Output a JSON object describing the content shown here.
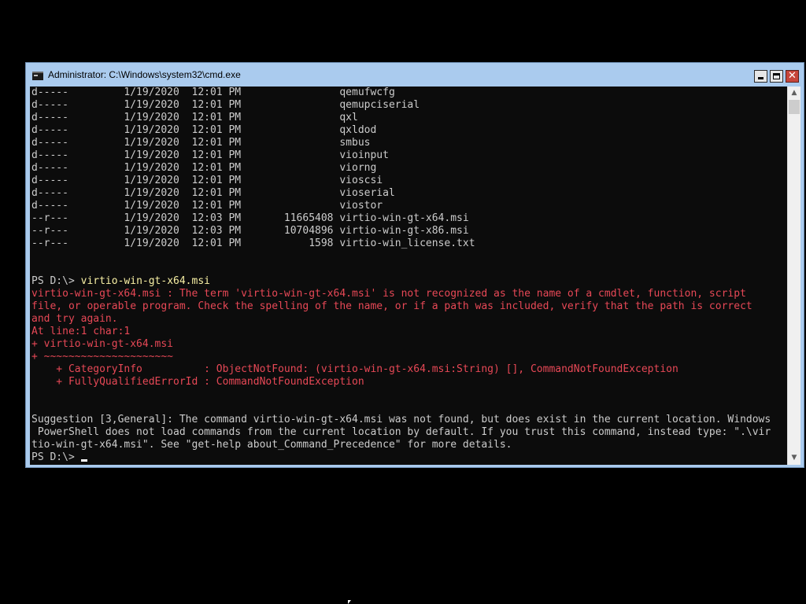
{
  "window": {
    "title": "Administrator: C:\\Windows\\system32\\cmd.exe",
    "icons": {
      "app": "console-icon",
      "minimize": "minimize-icon",
      "maximize": "maximize-icon",
      "close": "close-icon",
      "scroll_up": "chevron-up-icon",
      "scroll_down": "chevron-down-icon"
    },
    "close_glyph": "✕",
    "scroll_up_glyph": "▲",
    "scroll_down_glyph": "▼"
  },
  "colors": {
    "console_background": "#0c0c0c",
    "output_text": "#cccccc",
    "error_text": "#e74856",
    "command_text": "#f9f1a5",
    "titlebar": "#aacbee",
    "close_button": "#c7453a"
  },
  "console": {
    "listing": [
      "d-----         1/19/2020  12:01 PM                qemufwcfg",
      "d-----         1/19/2020  12:01 PM                qemupciserial",
      "d-----         1/19/2020  12:01 PM                qxl",
      "d-----         1/19/2020  12:01 PM                qxldod",
      "d-----         1/19/2020  12:01 PM                smbus",
      "d-----         1/19/2020  12:01 PM                vioinput",
      "d-----         1/19/2020  12:01 PM                viorng",
      "d-----         1/19/2020  12:01 PM                vioscsi",
      "d-----         1/19/2020  12:01 PM                vioserial",
      "d-----         1/19/2020  12:01 PM                viostor",
      "--r---         1/19/2020  12:03 PM       11665408 virtio-win-gt-x64.msi",
      "--r---         1/19/2020  12:03 PM       10704896 virtio-win-gt-x86.msi",
      "--r---         1/19/2020  12:01 PM           1598 virtio-win_license.txt"
    ],
    "prompt": "PS D:\\> ",
    "command": "virtio-win-gt-x64.msi",
    "error_lines": [
      "virtio-win-gt-x64.msi : The term 'virtio-win-gt-x64.msi' is not recognized as the name of a cmdlet, function, script",
      "file, or operable program. Check the spelling of the name, or if a path was included, verify that the path is correct",
      "and try again.",
      "At line:1 char:1",
      "+ virtio-win-gt-x64.msi",
      "+ ~~~~~~~~~~~~~~~~~~~~~",
      "    + CategoryInfo          : ObjectNotFound: (virtio-win-gt-x64.msi:String) [], CommandNotFoundException",
      "    + FullyQualifiedErrorId : CommandNotFoundException"
    ],
    "suggestion_lines": [
      "Suggestion [3,General]: The command virtio-win-gt-x64.msi was not found, but does exist in the current location. Windows",
      " PowerShell does not load commands from the current location by default. If you trust this command, instead type: \".\\vir",
      "tio-win-gt-x64.msi\". See \"get-help about_Command_Precedence\" for more details."
    ],
    "final_prompt": "PS D:\\> "
  }
}
